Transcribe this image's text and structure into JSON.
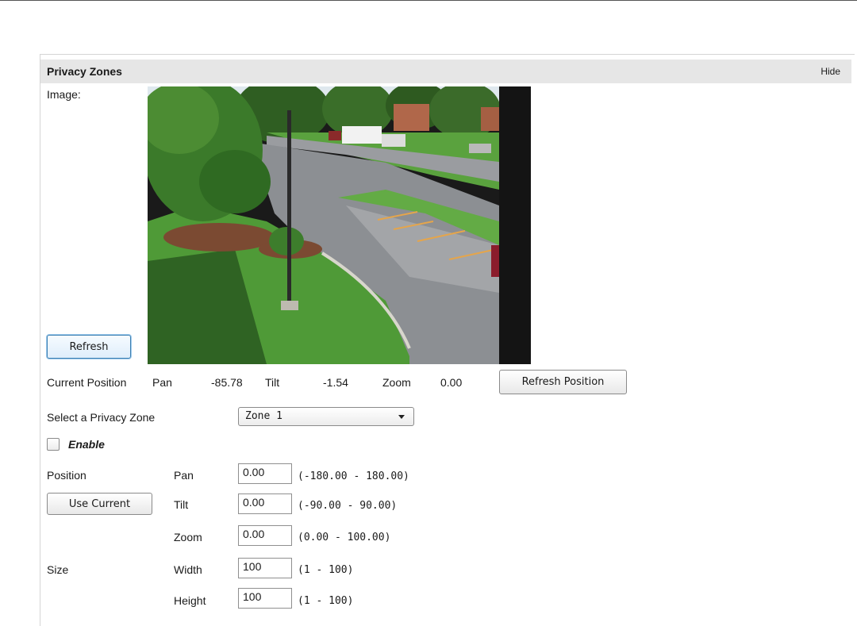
{
  "panel": {
    "title": "Privacy Zones",
    "hide_label": "Hide"
  },
  "image_section": {
    "label": "Image:",
    "refresh_label": "Refresh"
  },
  "current_position": {
    "label": "Current Position",
    "pan_label": "Pan",
    "pan_value": "-85.78",
    "tilt_label": "Tilt",
    "tilt_value": "-1.54",
    "zoom_label": "Zoom",
    "zoom_value": "0.00",
    "refresh_position_label": "Refresh Position"
  },
  "zone_select": {
    "label": "Select a Privacy Zone",
    "selected": "Zone 1"
  },
  "enable": {
    "label": "Enable",
    "checked": false
  },
  "position": {
    "label": "Position",
    "use_current_label": "Use Current",
    "pan": {
      "label": "Pan",
      "value": "0.00",
      "range": "(-180.00 - 180.00)"
    },
    "tilt": {
      "label": "Tilt",
      "value": "0.00",
      "range": "(-90.00 - 90.00)"
    },
    "zoom": {
      "label": "Zoom",
      "value": "0.00",
      "range": "(0.00 - 100.00)"
    }
  },
  "size": {
    "label": "Size",
    "width": {
      "label": "Width",
      "value": "100",
      "range": "(1 - 100)"
    },
    "height": {
      "label": "Height",
      "value": "100",
      "range": "(1 - 100)"
    }
  },
  "colors": {
    "header_bg": "#e6e6e6",
    "focus_border": "#3c7fb1",
    "grass": "#4f9a37",
    "asphalt": "#8c8f93"
  }
}
